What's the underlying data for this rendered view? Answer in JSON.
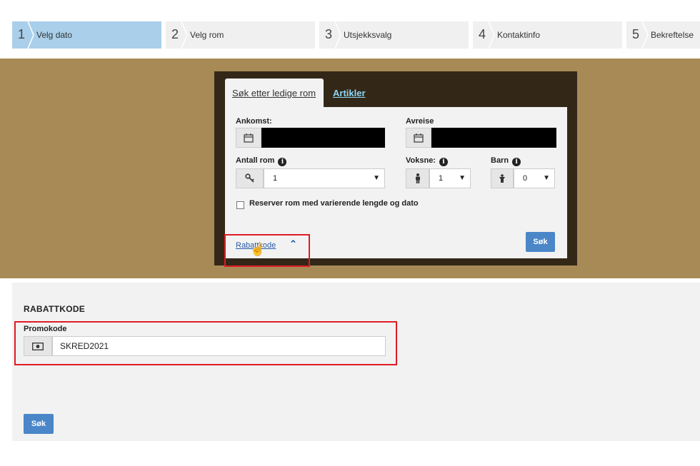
{
  "steps": [
    {
      "num": "1",
      "label": "Velg dato"
    },
    {
      "num": "2",
      "label": "Velg rom"
    },
    {
      "num": "3",
      "label": "Utsjekksvalg"
    },
    {
      "num": "4",
      "label": "Kontaktinfo"
    },
    {
      "num": "5",
      "label": "Bekreftelse"
    }
  ],
  "widget": {
    "tabs": {
      "search": "Søk etter ledige rom",
      "articles": "Artikler"
    },
    "arrival_label": "Ankomst:",
    "departure_label": "Avreise",
    "rooms_label": "Antall rom",
    "rooms_value": "1",
    "adults_label": "Voksne:",
    "adults_value": "1",
    "children_label": "Barn",
    "children_value": "0",
    "flex_checkbox_label": "Reserver rom med varierende lengde og dato",
    "discount_link": "Rabattkode",
    "search_button": "Søk"
  },
  "discount_section": {
    "title": "RABATTKODE",
    "promo_label": "Promokode",
    "promo_value": "SKRED2021",
    "search_button": "Søk"
  },
  "icons": {
    "calendar": "calendar-icon",
    "key": "key-icon",
    "adult": "person-icon",
    "child": "child-icon",
    "info": "info-icon",
    "cash": "cash-icon",
    "caret": "caret-up-icon",
    "cursor": "hand-cursor-icon"
  },
  "colors": {
    "active_step": "#a9cfea",
    "band": "#a78a55",
    "widget": "#332818",
    "button": "#4a86c8",
    "highlight": "#e01b24"
  }
}
